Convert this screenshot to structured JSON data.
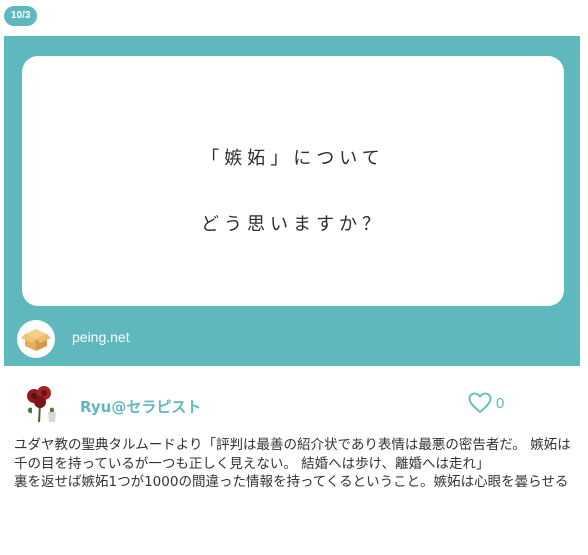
{
  "post": {
    "date_badge": "10/3",
    "question": {
      "line1": "「嫉妬」について",
      "line2": "どう思いますか？"
    },
    "source_site": "peing.net"
  },
  "answer": {
    "user_name": "Ryu@セラピスト",
    "likes": "0",
    "paragraphs": [
      "ユダヤ教の聖典タルムードより「評判は最善の紹介状であり表情は最悪の密告者だ。 嫉妬は千の目を持っているが一つも正しく見えない。 結婚へは歩け、離婚へは走れ」",
      "裏を返せば嫉妬1つが1000の間違った情報を持ってくるということ。嫉妬は心眼を曇らせる"
    ]
  },
  "colors": {
    "accent": "#5fb8bd",
    "text": "#333333",
    "background": "#ffffff"
  },
  "icons": {
    "peing_avatar": "cardboard-box-icon",
    "user_avatar": "rose-icon",
    "like": "heart-outline-icon"
  }
}
